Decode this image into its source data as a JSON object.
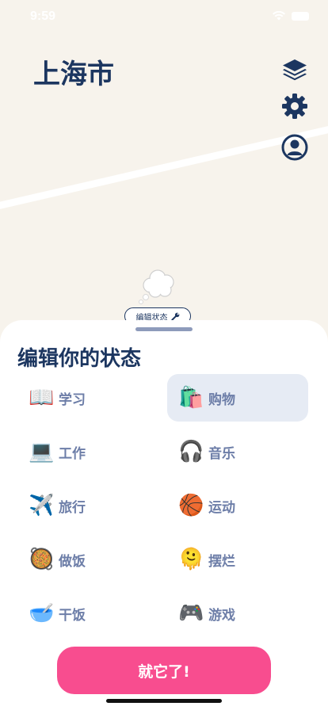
{
  "status_bar": {
    "time": "9:59"
  },
  "map": {
    "city": "上海市",
    "edit_status_label": "编辑状态"
  },
  "sheet": {
    "title": "编辑你的状态",
    "options": [
      {
        "emoji": "📖",
        "label": "学习",
        "selected": false
      },
      {
        "emoji": "🛍️",
        "label": "购物",
        "selected": true
      },
      {
        "emoji": "💻",
        "label": "工作",
        "selected": false
      },
      {
        "emoji": "🎧",
        "label": "音乐",
        "selected": false
      },
      {
        "emoji": "✈️",
        "label": "旅行",
        "selected": false
      },
      {
        "emoji": "🏀",
        "label": "运动",
        "selected": false
      },
      {
        "emoji": "🥘",
        "label": "做饭",
        "selected": false
      },
      {
        "emoji": "🫠",
        "label": "摆烂",
        "selected": false
      },
      {
        "emoji": "🥣",
        "label": "干饭",
        "selected": false
      },
      {
        "emoji": "🎮",
        "label": "游戏",
        "selected": false
      }
    ],
    "confirm_label": "就它了!"
  },
  "colors": {
    "primary": "#1c3660",
    "accent": "#f84d8f",
    "selected_bg": "#e6ebf4",
    "map_bg": "#f7f3ec"
  }
}
